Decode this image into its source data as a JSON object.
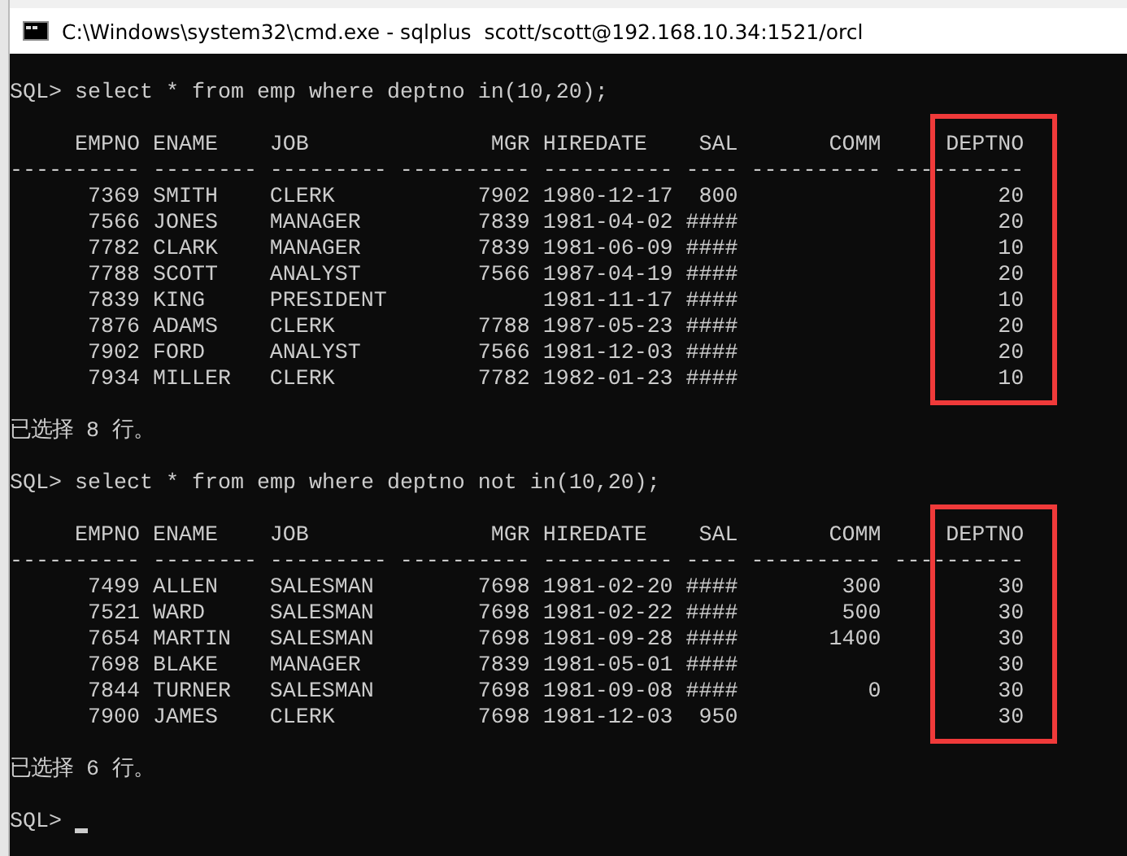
{
  "window": {
    "title": "C:\\Windows\\system32\\cmd.exe - sqlplus  scott/scott@192.168.10.34:1521/orcl"
  },
  "console": {
    "blocks": [
      {
        "kind": "query",
        "prompt": "SQL>",
        "command": "select * from emp where deptno in(10,20);"
      },
      {
        "kind": "result",
        "columns": [
          {
            "heading": "EMPNO",
            "rule": "----------",
            "kind": "number",
            "highlighted": false
          },
          {
            "heading": "ENAME",
            "rule": "--------",
            "kind": "text",
            "highlighted": false
          },
          {
            "heading": "JOB",
            "rule": "---------",
            "kind": "text",
            "highlighted": false
          },
          {
            "heading": "MGR",
            "rule": "----------",
            "kind": "number",
            "highlighted": false
          },
          {
            "heading": "HIREDATE",
            "rule": "----------",
            "kind": "text",
            "highlighted": false
          },
          {
            "heading": "SAL",
            "rule": "----",
            "kind": "number",
            "highlighted": false
          },
          {
            "heading": "COMM",
            "rule": "----------",
            "kind": "number",
            "highlighted": false
          },
          {
            "heading": "DEPTNO",
            "rule": "----------",
            "kind": "number",
            "highlighted": true
          }
        ],
        "rows": [
          [
            "7369",
            "SMITH",
            "CLERK",
            "7902",
            "1980-12-17",
            "800",
            null,
            "20"
          ],
          [
            "7566",
            "JONES",
            "MANAGER",
            "7839",
            "1981-04-02",
            "####",
            null,
            "20"
          ],
          [
            "7782",
            "CLARK",
            "MANAGER",
            "7839",
            "1981-06-09",
            "####",
            null,
            "10"
          ],
          [
            "7788",
            "SCOTT",
            "ANALYST",
            "7566",
            "1987-04-19",
            "####",
            null,
            "20"
          ],
          [
            "7839",
            "KING",
            "PRESIDENT",
            null,
            "1981-11-17",
            "####",
            null,
            "10"
          ],
          [
            "7876",
            "ADAMS",
            "CLERK",
            "7788",
            "1987-05-23",
            "####",
            null,
            "20"
          ],
          [
            "7902",
            "FORD",
            "ANALYST",
            "7566",
            "1981-12-03",
            "####",
            null,
            "20"
          ],
          [
            "7934",
            "MILLER",
            "CLERK",
            "7782",
            "1982-01-23",
            "####",
            null,
            "10"
          ]
        ]
      },
      {
        "kind": "message",
        "text": "已选择 8 行。"
      },
      {
        "kind": "query",
        "prompt": "SQL>",
        "command": "select * from emp where deptno not in(10,20);"
      },
      {
        "kind": "result",
        "columns": [
          {
            "heading": "EMPNO",
            "rule": "----------",
            "kind": "number",
            "highlighted": false
          },
          {
            "heading": "ENAME",
            "rule": "--------",
            "kind": "text",
            "highlighted": false
          },
          {
            "heading": "JOB",
            "rule": "---------",
            "kind": "text",
            "highlighted": false
          },
          {
            "heading": "MGR",
            "rule": "----------",
            "kind": "number",
            "highlighted": false
          },
          {
            "heading": "HIREDATE",
            "rule": "----------",
            "kind": "text",
            "highlighted": false
          },
          {
            "heading": "SAL",
            "rule": "----",
            "kind": "number",
            "highlighted": false
          },
          {
            "heading": "COMM",
            "rule": "----------",
            "kind": "number",
            "highlighted": false
          },
          {
            "heading": "DEPTNO",
            "rule": "----------",
            "kind": "number",
            "highlighted": true
          }
        ],
        "rows": [
          [
            "7499",
            "ALLEN",
            "SALESMAN",
            "7698",
            "1981-02-20",
            "####",
            "300",
            "30"
          ],
          [
            "7521",
            "WARD",
            "SALESMAN",
            "7698",
            "1981-02-22",
            "####",
            "500",
            "30"
          ],
          [
            "7654",
            "MARTIN",
            "SALESMAN",
            "7698",
            "1981-09-28",
            "####",
            "1400",
            "30"
          ],
          [
            "7698",
            "BLAKE",
            "MANAGER",
            "7839",
            "1981-05-01",
            "####",
            null,
            "30"
          ],
          [
            "7844",
            "TURNER",
            "SALESMAN",
            "7698",
            "1981-09-08",
            "####",
            "0",
            "30"
          ],
          [
            "7900",
            "JAMES",
            "CLERK",
            "7698",
            "1981-12-03",
            "950",
            null,
            "30"
          ]
        ]
      },
      {
        "kind": "message",
        "text": "已选择 6 行。"
      },
      {
        "kind": "prompt",
        "prompt": "SQL>",
        "cursor": true
      }
    ]
  }
}
